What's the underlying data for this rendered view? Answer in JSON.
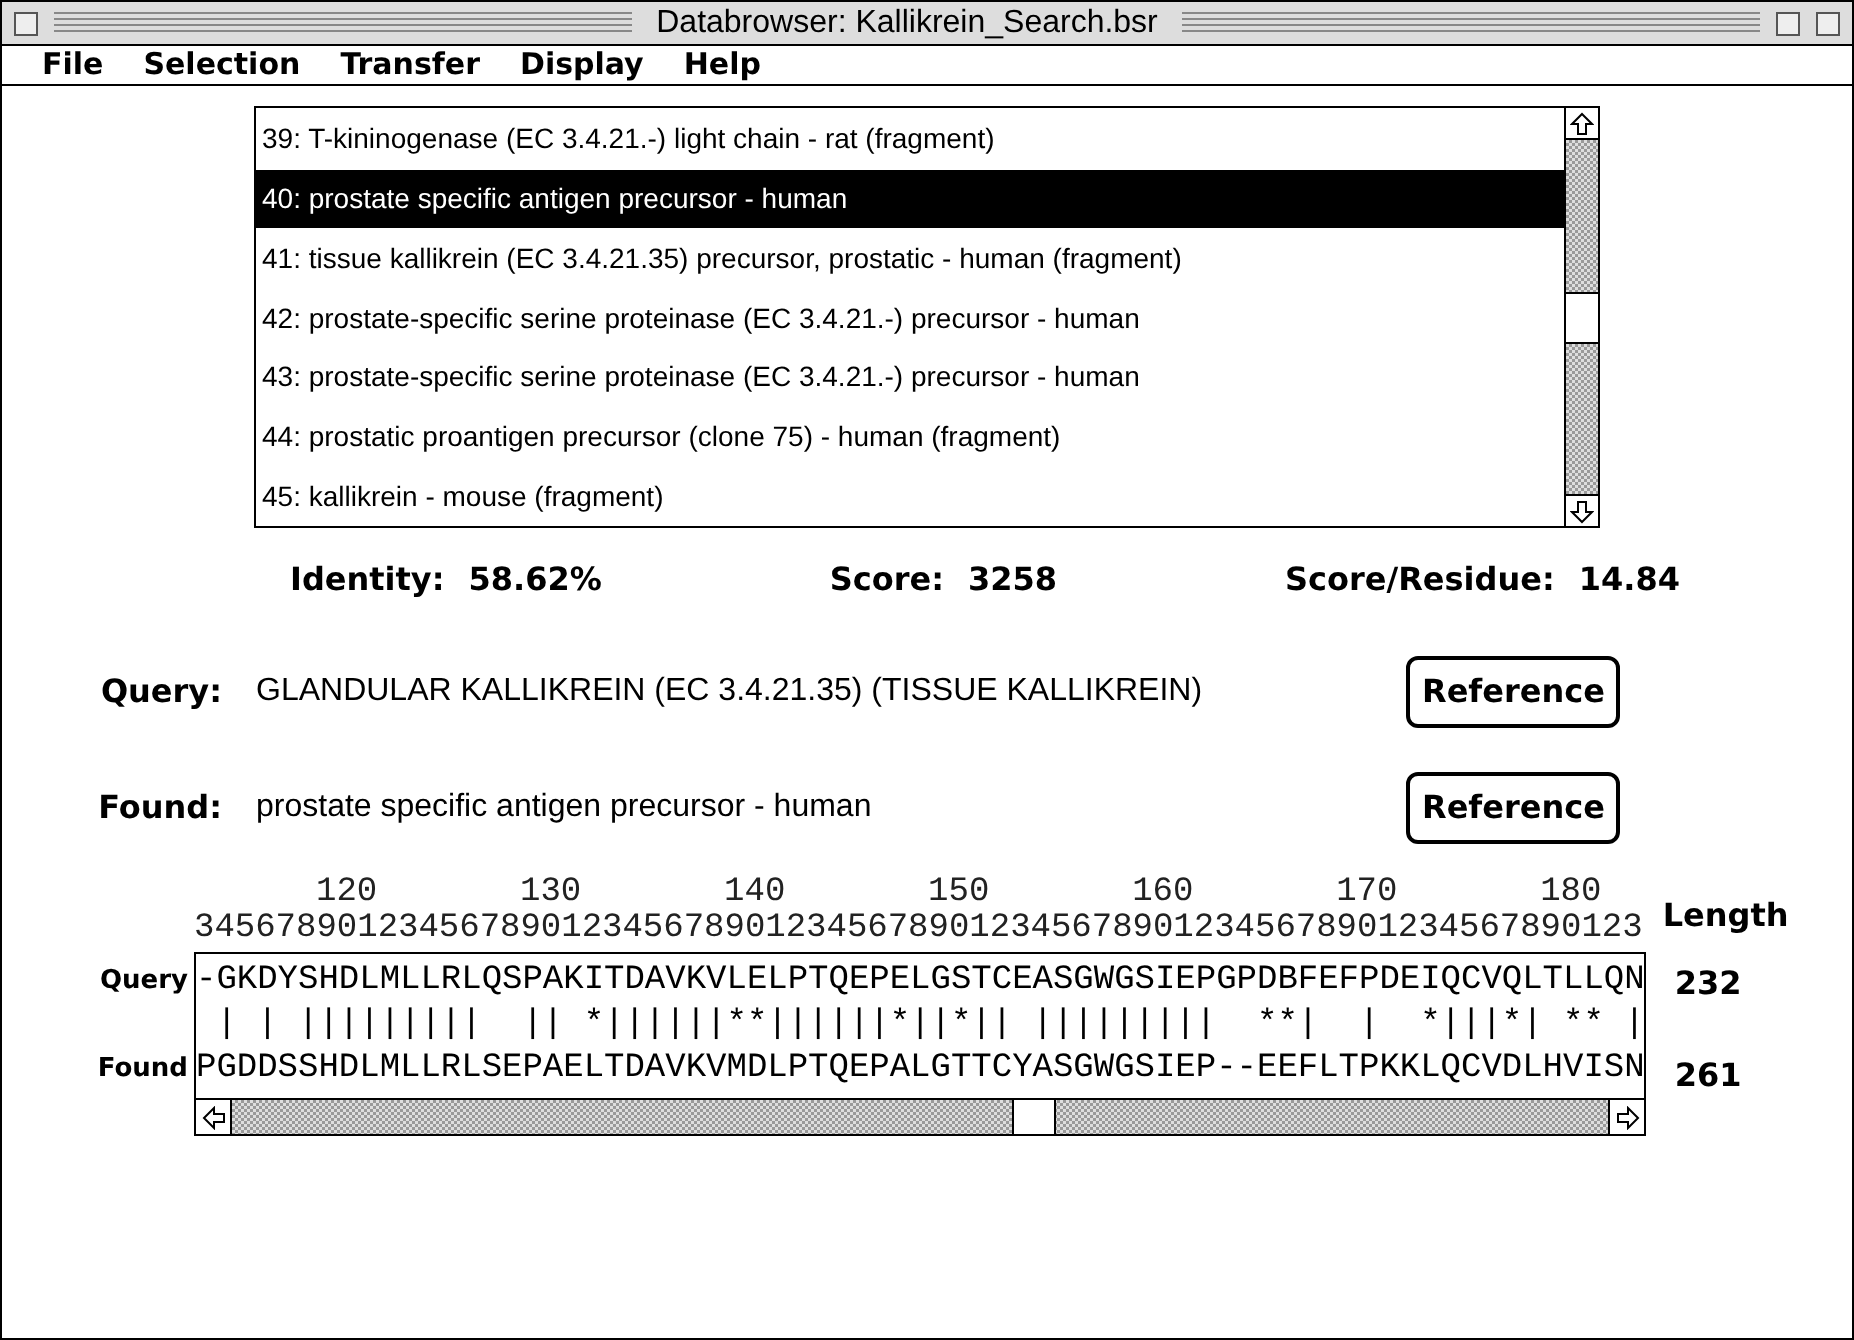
{
  "window": {
    "title": "Databrowser: Kallikrein_Search.bsr"
  },
  "menu": [
    "File",
    "Selection",
    "Transfer",
    "Display",
    "Help"
  ],
  "results": [
    {
      "text": "39: T-kininogenase (EC 3.4.21.-) light chain - rat (fragment)",
      "selected": false
    },
    {
      "text": "40: prostate specific antigen precursor - human",
      "selected": true
    },
    {
      "text": "41: tissue kallikrein (EC 3.4.21.35) precursor, prostatic - human (fragment)",
      "selected": false
    },
    {
      "text": "42: prostate-specific serine proteinase (EC 3.4.21.-) precursor - human",
      "selected": false
    },
    {
      "text": "43: prostate-specific serine proteinase (EC 3.4.21.-) precursor - human",
      "selected": false
    },
    {
      "text": "44: prostatic proantigen precursor (clone 75) - human (fragment)",
      "selected": false
    },
    {
      "text": "45: kallikrein - mouse (fragment)",
      "selected": false
    }
  ],
  "stats": [
    {
      "label": "Identity:",
      "value": "58.62%"
    },
    {
      "label": "Score:",
      "value": "3258"
    },
    {
      "label": "Score/Residue:",
      "value": "14.84"
    }
  ],
  "sequences": [
    {
      "label": "Query:",
      "description": "GLANDULAR KALLIKREIN (EC 3.4.21.35) (TISSUE KALLIKREIN)",
      "button": "Reference"
    },
    {
      "label": "Found:",
      "description": "prostate specific antigen precursor - human",
      "button": "Reference"
    }
  ],
  "alignment": {
    "ruler_tens": [
      "120",
      "130",
      "140",
      "150",
      "160",
      "170",
      "180"
    ],
    "ruler_units": "34567890123456789012345678901234567890123456789012345678901234567890123",
    "length_header": "Length",
    "query": {
      "label": "Query",
      "sequence": "-GKDYSHDLMLLRLQSPAKITDAVKVLELPTQEPELGSTCEASGWGSIEPGPDBFEFPDEIQCVQLTLLQN",
      "length": "232"
    },
    "match_line": " | | |||||||||  || *||||||**||||||*||*|| |||||||||  **|  |  *|||*| ** |",
    "found": {
      "label": "Found",
      "sequence": "PGDDSSHDLMLLRLSEPAELTDAVKVMDLPTQEPALGTTCYASGWGSIEP--EEFLTPKKLQCVDLHVISN",
      "length": "261"
    }
  }
}
